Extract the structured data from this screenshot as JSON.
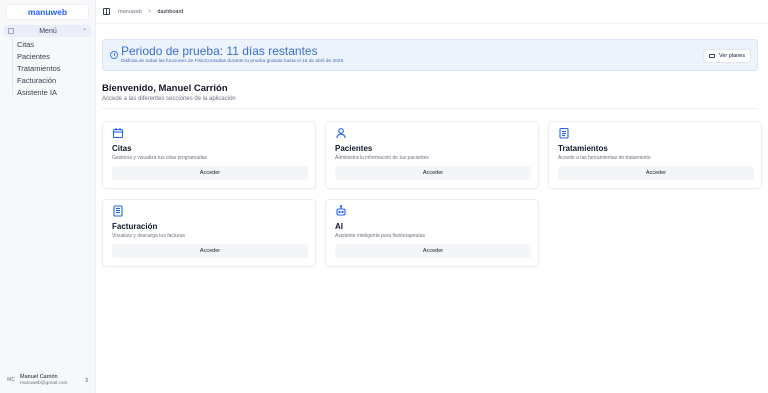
{
  "sidebar": {
    "brand": "manuweb",
    "menu_label": "Menú",
    "items": [
      {
        "label": "Citas"
      },
      {
        "label": "Pacientes"
      },
      {
        "label": "Tratamientos"
      },
      {
        "label": "Facturación"
      },
      {
        "label": "Asistente IA"
      }
    ],
    "user": {
      "initials": "MC",
      "name": "Manuel Carrión",
      "email": "manuweb@gmail.com"
    }
  },
  "breadcrumb": {
    "root": "manuweb",
    "separator": ">",
    "current": "dashboard"
  },
  "trial": {
    "title": "Periodo de prueba: 11 días restantes",
    "description": "Disfruta de todas las funciones de FisioConsultas durante tu prueba gratuita hasta el 16 de abril de 2025.",
    "button_label": "Ver planes"
  },
  "welcome": {
    "title": "Bienvenido, Manuel Carrión",
    "subtitle": "Accede a las diferentes secciones de la aplicación"
  },
  "cards": [
    {
      "title": "Citas",
      "description": "Gestiona y visualiza tus citas programadas",
      "button": "Acceder",
      "icon": "calendar-icon"
    },
    {
      "title": "Pacientes",
      "description": "Administra la información de tus pacientes",
      "button": "Acceder",
      "icon": "user-icon"
    },
    {
      "title": "Tratamientos",
      "description": "Accede a las herramientas de tratamiento",
      "button": "Acceder",
      "icon": "clipboard-icon"
    },
    {
      "title": "Facturación",
      "description": "Visualiza y descarga tus facturas",
      "button": "Acceder",
      "icon": "document-icon"
    },
    {
      "title": "AI",
      "description": "Asistente inteligente para fisioterapeutas",
      "button": "Acceder",
      "icon": "robot-icon"
    }
  ],
  "colors": {
    "accent": "#2563eb",
    "trial_bg": "#edf3fc"
  }
}
